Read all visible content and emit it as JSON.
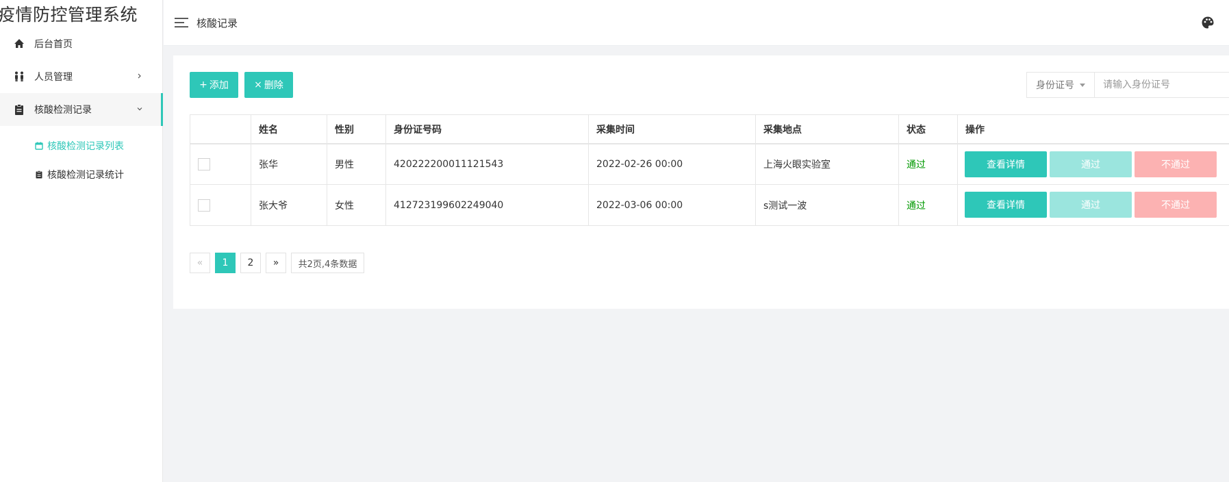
{
  "sidebar": {
    "app_title": "疫情防控管理系统",
    "menu": [
      {
        "label": "后台首页",
        "icon": "home-icon"
      },
      {
        "label": "人员管理",
        "icon": "people-icon"
      },
      {
        "label": "核酸检测记录",
        "icon": "clipboard-icon"
      }
    ],
    "submenu": [
      {
        "label": "核酸检测记录列表",
        "icon": "calendar-icon",
        "active": true
      },
      {
        "label": "核酸检测记录统计",
        "icon": "clipboard-icon",
        "active": false
      }
    ]
  },
  "header": {
    "title": "核酸记录",
    "menu_icon": "hamburger-icon",
    "theme_icon": "palette-icon"
  },
  "toolbar": {
    "add_label": "添加",
    "add_icon": "+",
    "delete_label": "删除",
    "delete_icon": "×",
    "search_field": "身份证号",
    "search_placeholder": "请输入身份证号"
  },
  "table": {
    "columns": [
      "",
      "姓名",
      "性别",
      "身份证号码",
      "采集时间",
      "采集地点",
      "状态",
      "操作"
    ],
    "rows": [
      {
        "name": "张华",
        "gender": "男性",
        "id_number": "420222200011121543",
        "time": "2022-02-26 00:00",
        "location": "上海火眼实验室",
        "status": "通过"
      },
      {
        "name": "张大爷",
        "gender": "女性",
        "id_number": "412723199602249040",
        "time": "2022-03-06 00:00",
        "location": "s测试一波",
        "status": "通过"
      }
    ],
    "actions": {
      "view": "查看详情",
      "pass": "通过",
      "fail": "不通过"
    }
  },
  "pagination": {
    "prev": "«",
    "pages": [
      "1",
      "2"
    ],
    "current": "1",
    "next": "»",
    "summary": "共2页,4条数据"
  },
  "colors": {
    "accent": "#2ec7b8",
    "pass_light": "#9be5de",
    "fail_light": "#fcb2b2",
    "status_pass": "#009900"
  }
}
